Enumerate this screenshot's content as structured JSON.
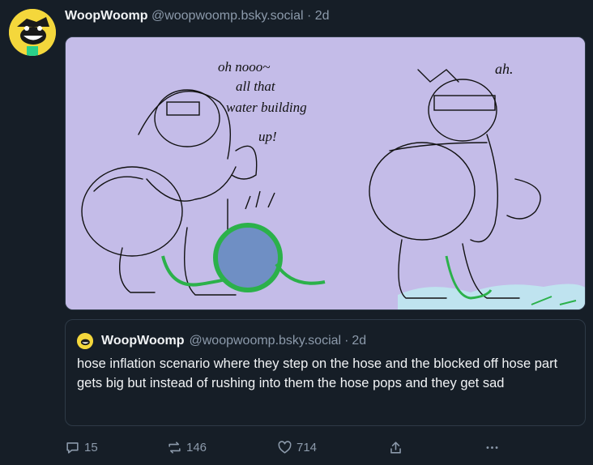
{
  "post": {
    "author_name": "WoopWoomp",
    "author_handle": "@woopwoomp.bsky.social",
    "separator": "·",
    "time": "2d",
    "image_texts": {
      "left_bubble": [
        "oh nooo~",
        "all that",
        "water building",
        "up!"
      ],
      "right_bubble": "ah."
    }
  },
  "quote": {
    "author_name": "WoopWoomp",
    "author_handle": "@woopwoomp.bsky.social",
    "separator": "·",
    "time": "2d",
    "text": "hose inflation scenario where they step on the hose and the blocked off hose part gets big but instead of rushing into them the hose pops and they get sad"
  },
  "actions": {
    "reply_count": "15",
    "repost_count": "146",
    "like_count": "714"
  },
  "colors": {
    "background": "#161e27",
    "image_bg": "#c4bce8",
    "hose_green": "#2bb14a",
    "balloon_blue": "#6f8fc4",
    "muted_text": "#8c9aab",
    "avatar_yellow": "#f4d73c"
  },
  "icons": [
    "avatar",
    "reply-icon",
    "repost-icon",
    "like-icon",
    "share-icon",
    "more-icon"
  ]
}
